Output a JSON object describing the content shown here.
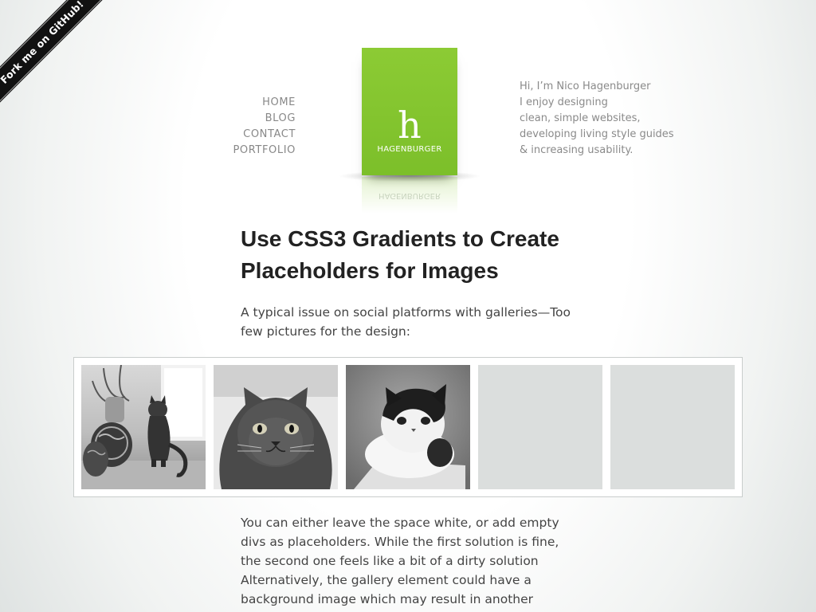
{
  "ribbon": {
    "label": "Fork me on GitHub!"
  },
  "nav": {
    "items": [
      {
        "label": "HOME"
      },
      {
        "label": "BLOG"
      },
      {
        "label": "CONTACT"
      },
      {
        "label": "PORTFOLIO"
      }
    ]
  },
  "logo": {
    "mark": "h",
    "text": "HAGENBURGER",
    "color": "#84c431"
  },
  "intro": {
    "lines": [
      "Hi, I’m Nico Hagenburger",
      "I enjoy designing",
      "clean, simple websites,",
      "developing living style guides",
      "& increasing usability."
    ]
  },
  "article": {
    "title": "Use CSS3 Gradients to Create Placeholders for Images",
    "lead": "A typical issue on social platforms with galleries—Too few pictures for the design:",
    "body_lines": [
      "You can either leave the space white, or add empty",
      "divs as placeholders. While the first solution is fine,",
      "the second one feels like a bit of a dirty solution",
      "Alternatively, the gallery element could have a",
      "background image which may result in another"
    ]
  },
  "gallery": {
    "tiles": [
      {
        "kind": "photo",
        "icon": "cat-with-vases-photo"
      },
      {
        "kind": "photo",
        "icon": "persian-cat-face-photo"
      },
      {
        "kind": "photo",
        "icon": "white-persian-cat-photo"
      },
      {
        "kind": "placeholder"
      },
      {
        "kind": "placeholder"
      }
    ],
    "placeholder_color": "#dbdedd"
  }
}
